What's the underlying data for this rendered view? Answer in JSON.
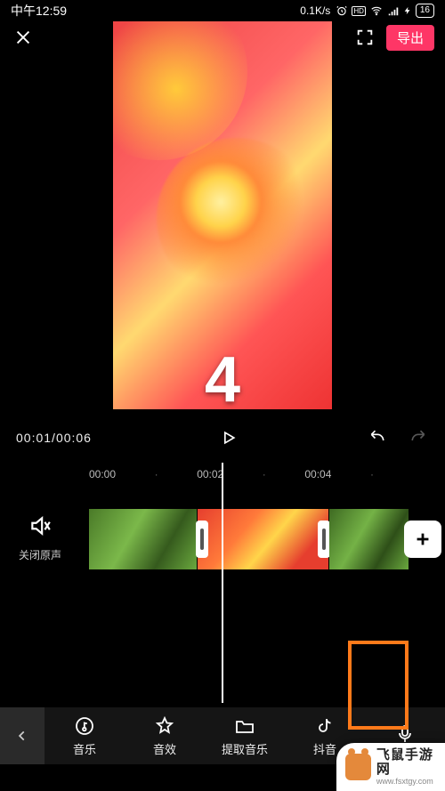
{
  "status": {
    "time": "中午12:59",
    "net_speed": "0.1K/s",
    "battery": "16"
  },
  "topbar": {
    "export_label": "导出"
  },
  "preview": {
    "countdown": "4"
  },
  "playback": {
    "current": "00:01",
    "total": "00:06"
  },
  "ruler": {
    "t0": "00:00",
    "t1": "00:02",
    "t2": "00:04"
  },
  "mute": {
    "label": "关闭原声"
  },
  "toolbar": {
    "back_aria": "返回",
    "items": [
      {
        "id": "music",
        "label": "音乐"
      },
      {
        "id": "effects",
        "label": "音效"
      },
      {
        "id": "extract",
        "label": "提取音乐"
      },
      {
        "id": "douyin",
        "label": "抖音"
      },
      {
        "id": "record",
        "label": ""
      }
    ]
  },
  "watermark": {
    "line1": "飞鼠手游网",
    "line2": "www.fsxtgy.com"
  }
}
